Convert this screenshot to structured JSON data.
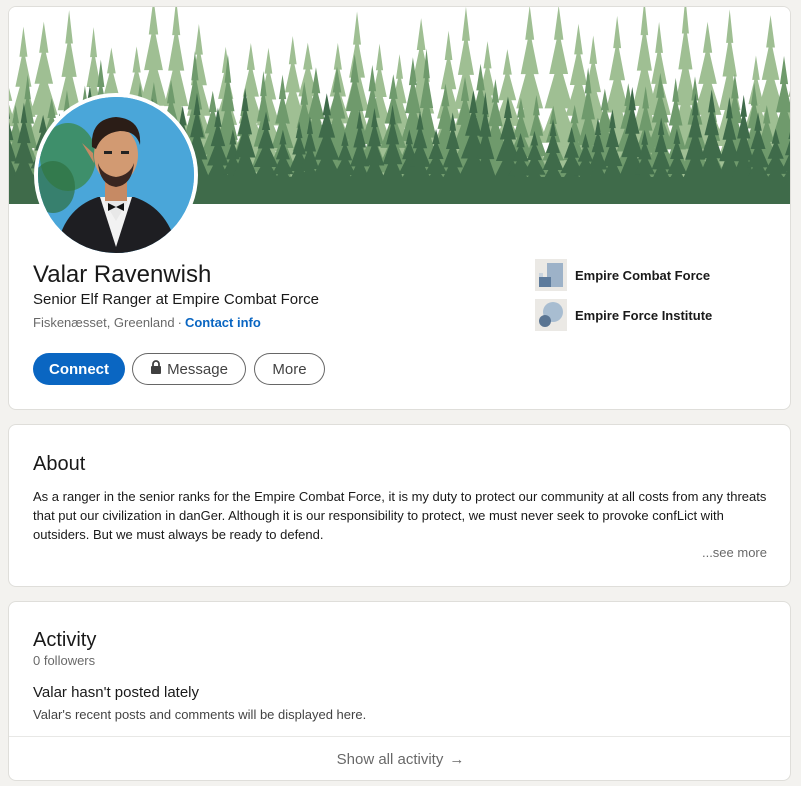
{
  "profile": {
    "name": "Valar Ravenwish",
    "headline": "Senior Elf Ranger at Empire Combat Force",
    "location": "Fiskenæsset, Greenland",
    "location_separator": "·",
    "contact_info": "Contact info",
    "buttons": {
      "connect": "Connect",
      "message": "Message",
      "more": "More"
    },
    "organizations": [
      {
        "name": "Empire Combat Force",
        "icon": "company-logo-icon"
      },
      {
        "name": "Empire Force Institute",
        "icon": "school-logo-icon"
      }
    ]
  },
  "about": {
    "title": "About",
    "text": "As a ranger in the senior ranks for the Empire Combat Force, it is my duty to protect our community at all costs from any threats that put our civilization in danGer. Although it is our responsibility to protect, we must never seek to provoke confLict with outsiders. But we must always be ready to defend.",
    "see_more": "...see more"
  },
  "activity": {
    "title": "Activity",
    "followers": "0 followers",
    "empty_title": "Valar hasn't posted lately",
    "empty_subtitle": "Valar's recent posts and comments will be displayed here.",
    "show_all": "Show all activity",
    "show_all_arrow": "→"
  },
  "colors": {
    "accent": "#0a66c2",
    "banner_dark": "#3f6b4a",
    "banner_light": "#9fbf93"
  }
}
